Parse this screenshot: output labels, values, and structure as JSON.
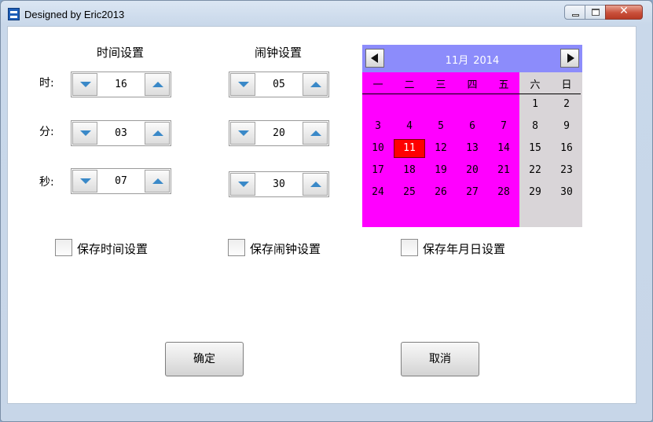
{
  "window": {
    "title": "Designed by Eric2013",
    "icon": "app-logo-icon",
    "controls": {
      "minimize": "minimize-icon",
      "maximize": "maximize-icon",
      "close": "close-icon",
      "close_glyph": "✕"
    }
  },
  "time_settings": {
    "heading": "时间设置",
    "labels": {
      "hour": "时:",
      "minute": "分:",
      "second": "秒:"
    },
    "hour": "16",
    "minute": "03",
    "second": "07"
  },
  "alarm_settings": {
    "heading": "闹钟设置",
    "hour": "05",
    "minute": "20",
    "second": "30"
  },
  "spinner_icons": {
    "decrement": "arrow-down-icon",
    "increment": "arrow-up-icon"
  },
  "calendar": {
    "month": "11月",
    "year": "2014",
    "weekdays": [
      "一",
      "二",
      "三",
      "四",
      "五",
      "六",
      "日"
    ],
    "weeks": [
      [
        "",
        "",
        "",
        "",
        "",
        "1",
        "2"
      ],
      [
        "3",
        "4",
        "5",
        "6",
        "7",
        "8",
        "9"
      ],
      [
        "10",
        "11",
        "12",
        "13",
        "14",
        "15",
        "16"
      ],
      [
        "17",
        "18",
        "19",
        "20",
        "21",
        "22",
        "23"
      ],
      [
        "24",
        "25",
        "26",
        "27",
        "28",
        "29",
        "30"
      ]
    ],
    "selected_day": "11",
    "nav_icons": {
      "prev": "triangle-left-icon",
      "next": "triangle-right-icon"
    },
    "colors": {
      "header": "#8c8cfb",
      "weekday_bg": "#ff00ff",
      "weekend_bg": "#d9d5d8",
      "selected": "#ff0000"
    }
  },
  "checkboxes": {
    "save_time": {
      "label": "保存时间设置",
      "checked": false
    },
    "save_alarm": {
      "label": "保存闹钟设置",
      "checked": false
    },
    "save_date": {
      "label": "保存年月日设置",
      "checked": false
    }
  },
  "buttons": {
    "ok": "确定",
    "cancel": "取消"
  }
}
